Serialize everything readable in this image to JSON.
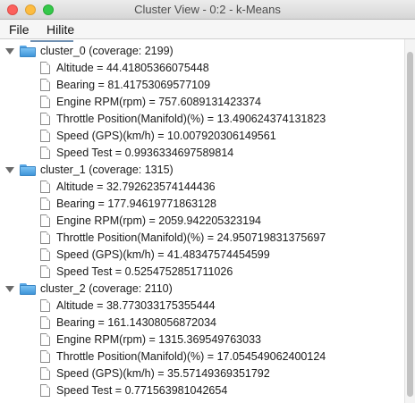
{
  "window": {
    "title": "Cluster View - 0:2 - k-Means"
  },
  "menu": {
    "file": "File",
    "hilite": "Hilite"
  },
  "clusters": [
    {
      "label": "cluster_0 (coverage: 2199)",
      "items": [
        "Altitude = 44.41805366075448",
        "Bearing = 81.41753069577109",
        "Engine RPM(rpm) = 757.6089131423374",
        "Throttle Position(Manifold)(%) = 13.490624374131823",
        "Speed (GPS)(km/h) = 10.007920306149561",
        "Speed Test = 0.9936334697589814"
      ]
    },
    {
      "label": "cluster_1 (coverage: 1315)",
      "items": [
        "Altitude = 32.792623574144436",
        "Bearing = 177.94619771863128",
        "Engine RPM(rpm) = 2059.942205323194",
        "Throttle Position(Manifold)(%) = 24.950719831375697",
        "Speed (GPS)(km/h) = 41.48347574454599",
        "Speed Test = 0.5254752851711026"
      ]
    },
    {
      "label": "cluster_2 (coverage: 2110)",
      "items": [
        "Altitude = 38.773033175355444",
        "Bearing = 161.14308056872034",
        "Engine RPM(rpm) = 1315.369549763033",
        "Throttle Position(Manifold)(%) = 17.054549062400124",
        "Speed (GPS)(km/h) = 35.57149369351792",
        "Speed Test = 0.771563981042654"
      ]
    }
  ]
}
